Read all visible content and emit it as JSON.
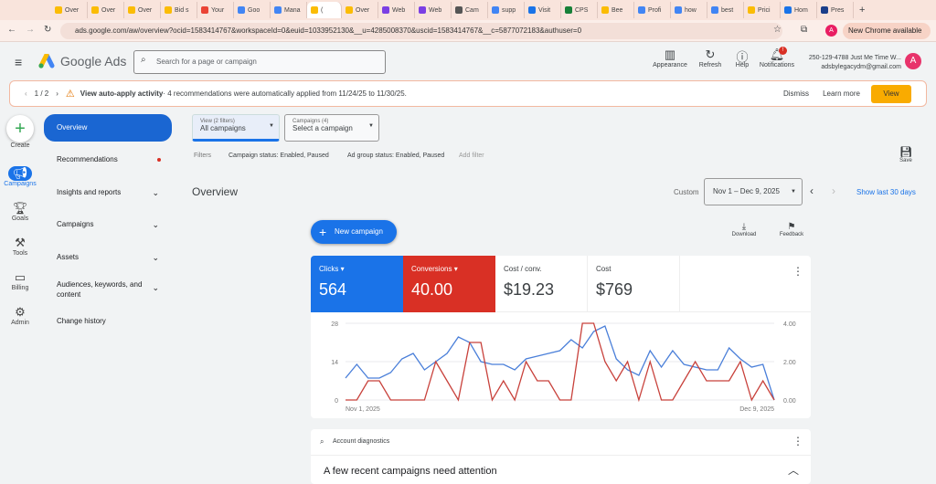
{
  "browser": {
    "tabs": [
      {
        "label": "Over",
        "color": "#fbbc04"
      },
      {
        "label": "Over",
        "color": "#fbbc04"
      },
      {
        "label": "Over",
        "color": "#fbbc04"
      },
      {
        "label": "Bid s",
        "color": "#fbbc04"
      },
      {
        "label": "Your",
        "color": "#ea4335"
      },
      {
        "label": "Goo",
        "color": "#4285f4"
      },
      {
        "label": "Mana",
        "color": "#4285f4"
      },
      {
        "label": "(",
        "color": "#fbbc04",
        "active": true
      },
      {
        "label": "Over",
        "color": "#fbbc04"
      },
      {
        "label": "Web",
        "color": "#7b3fe4"
      },
      {
        "label": "Web",
        "color": "#7b3fe4"
      },
      {
        "label": "Cam",
        "color": "#555"
      },
      {
        "label": "supp",
        "color": "#4285f4"
      },
      {
        "label": "Visit",
        "color": "#1a73e8"
      },
      {
        "label": "CPS",
        "color": "#188038"
      },
      {
        "label": "Bee",
        "color": "#fbbc04"
      },
      {
        "label": "Profi",
        "color": "#4285f4"
      },
      {
        "label": "how",
        "color": "#4285f4"
      },
      {
        "label": "best",
        "color": "#4285f4"
      },
      {
        "label": "Prici",
        "color": "#fbbc04"
      },
      {
        "label": "Hom",
        "color": "#1a73e8"
      },
      {
        "label": "Pres",
        "color": "#1a3e8a"
      }
    ],
    "url": "ads.google.com/aw/overview?ocid=1583414767&workspaceId=0&euid=1033952130&__u=4285008370&uscid=1583414767&__c=5877072183&authuser=0",
    "new_chrome": "New Chrome available",
    "profile_initial": "A"
  },
  "header": {
    "product": "Google Ads",
    "search_placeholder": "Search for a page or campaign",
    "actions": [
      "Appearance",
      "Refresh",
      "Help",
      "Notifications"
    ],
    "notification_badge": "!",
    "account_name": "250-129-4788 Just Me Time W...",
    "account_email": "adsbylegacydm@gmail.com",
    "avatar": "A"
  },
  "banner": {
    "pager": "1 / 2",
    "title": "View auto-apply activity",
    "text": " · 4 recommendations were automatically applied from 11/24/25 to 11/30/25.",
    "dismiss": "Dismiss",
    "learn_more": "Learn more",
    "view": "View"
  },
  "rail": [
    "Create",
    "Campaigns",
    "Goals",
    "Tools",
    "Billing",
    "Admin"
  ],
  "nav": {
    "overview": "Overview",
    "recommendations": "Recommendations",
    "insights": "Insights and reports",
    "campaigns": "Campaigns",
    "assets": "Assets",
    "audiences": "Audiences, keywords, and content",
    "change_history": "Change history"
  },
  "filters": {
    "view_label": "View (2 filters)",
    "view_value": "All campaigns",
    "campaigns_label": "Campaigns (4)",
    "campaigns_value": "Select a campaign",
    "filters_label": "Filters",
    "chips": [
      "Campaign status: Enabled, Paused",
      "Ad group status: Enabled, Paused"
    ],
    "add_filter": "Add filter",
    "save": "Save"
  },
  "overview": {
    "title": "Overview",
    "range_type": "Custom",
    "date_range": "Nov 1 – Dec 9, 2025",
    "show_last": "Show last 30 days",
    "new_campaign": "New campaign",
    "download": "Download",
    "feedback": "Feedback"
  },
  "metrics": [
    {
      "label": "Clicks",
      "value": "564",
      "color": "#1a73e8"
    },
    {
      "label": "Conversions",
      "value": "40.00",
      "color": "#d93025"
    },
    {
      "label": "Cost / conv.",
      "value": "$19.23"
    },
    {
      "label": "Cost",
      "value": "$769"
    }
  ],
  "chart_data": {
    "type": "line",
    "x_start": "Nov 1, 2025",
    "x_end": "Dec 9, 2025",
    "left_ticks": [
      "0",
      "14",
      "28"
    ],
    "right_ticks": [
      "0.00",
      "2.00",
      "4.00"
    ],
    "ylim_left": [
      0,
      28
    ],
    "ylim_right": [
      0,
      4
    ],
    "series": [
      {
        "name": "Clicks",
        "axis": "left",
        "color": "#4a7fd9",
        "values": [
          8,
          13,
          8,
          8,
          10,
          15,
          17,
          11,
          14,
          17,
          23,
          21,
          14,
          13,
          13,
          11,
          15,
          16,
          17,
          18,
          22,
          19,
          25,
          27,
          15,
          11,
          9,
          18,
          12,
          18,
          13,
          12,
          11,
          11,
          19,
          15,
          12,
          13,
          0
        ]
      },
      {
        "name": "Conversions",
        "axis": "right",
        "color": "#c8413b",
        "values": [
          0,
          0,
          1,
          1,
          0,
          0,
          0,
          0,
          2,
          1,
          0,
          3,
          3,
          0,
          1,
          0,
          2,
          1,
          1,
          0,
          0,
          4,
          4,
          2,
          1,
          2,
          0,
          2,
          0,
          0,
          1,
          2,
          1,
          1,
          1,
          2,
          0,
          1,
          0
        ]
      }
    ]
  },
  "diagnostics": {
    "label": "Account diagnostics",
    "heading": "A few recent campaigns need attention"
  }
}
